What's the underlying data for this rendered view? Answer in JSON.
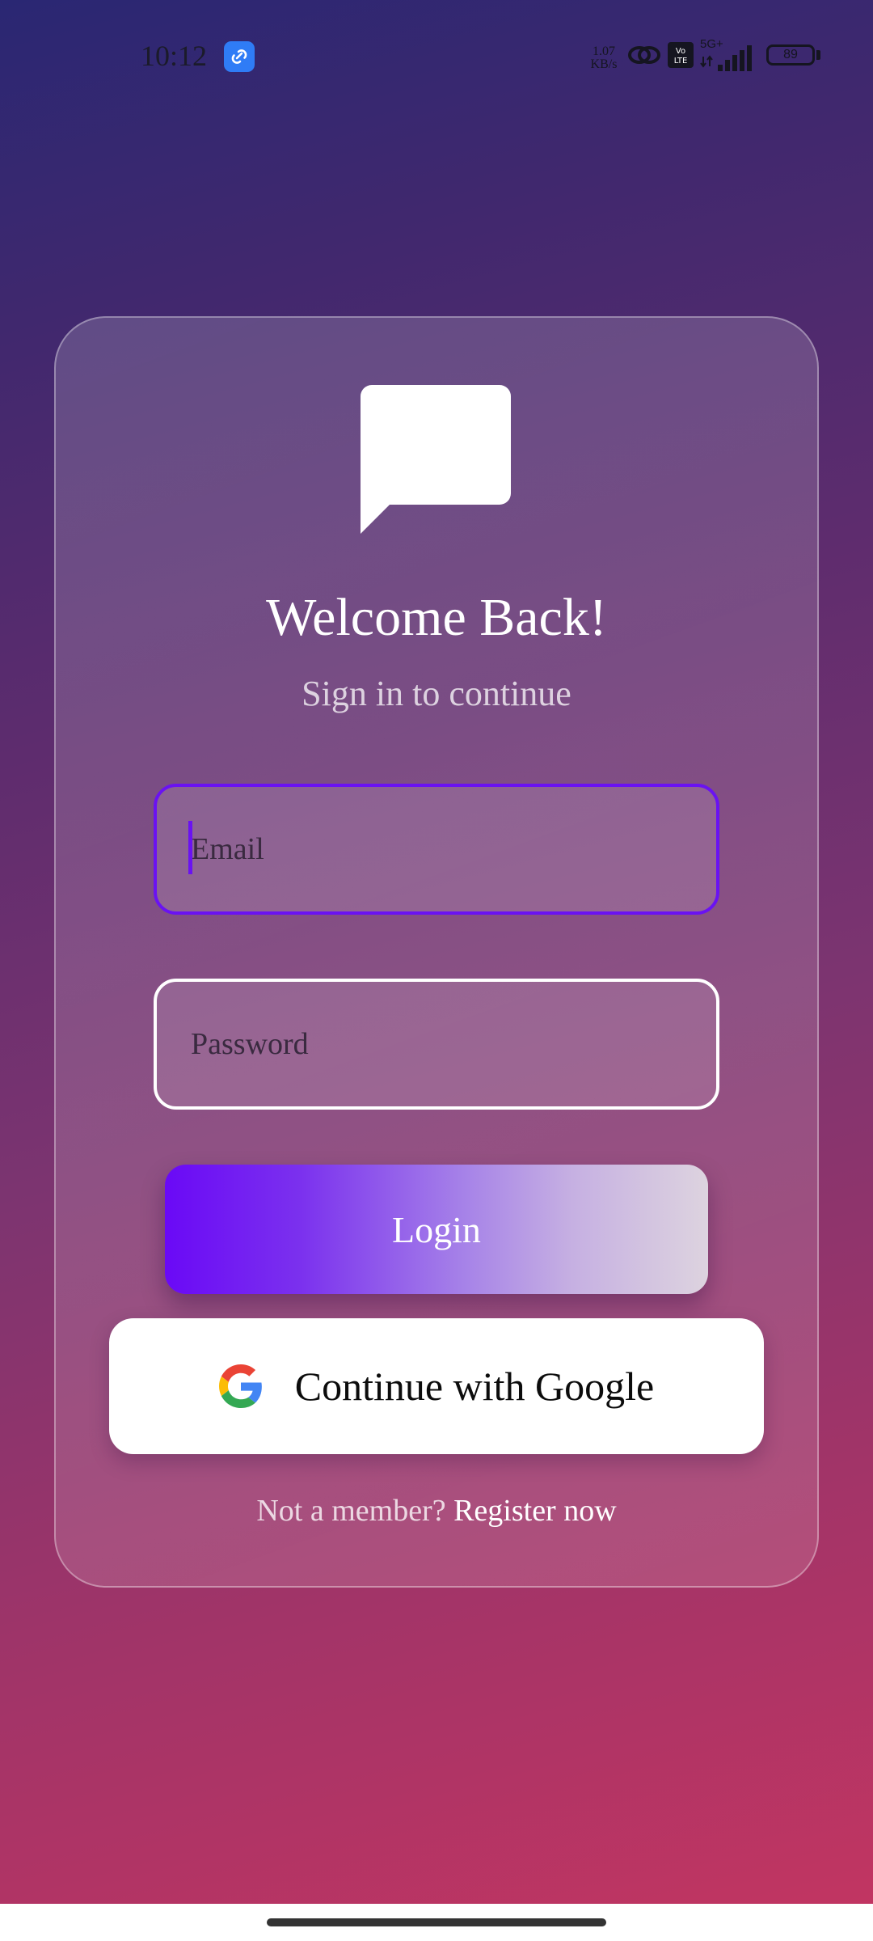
{
  "status_bar": {
    "time": "10:12",
    "net_speed_value": "1.07",
    "net_speed_unit": "KB/s",
    "volte_badge": "Vo LTE",
    "network_type": "5G+",
    "battery_level": "89",
    "icons": [
      "link-app-icon",
      "hotspot-link-icon",
      "volte-icon",
      "signal-icon",
      "battery-icon"
    ]
  },
  "login": {
    "logo_icon": "chat-bubble-icon",
    "title": "Welcome Back!",
    "subtitle": "Sign in to continue",
    "email_placeholder": "Email",
    "password_placeholder": "Password",
    "login_label": "Login",
    "google_label": "Continue with Google",
    "google_icon": "google-g-icon",
    "not_member_text": "Not a member?",
    "register_link": "Register now"
  },
  "colors": {
    "accent": "#6a12f2",
    "background_top": "#2a2773",
    "background_bottom": "#c43561"
  }
}
